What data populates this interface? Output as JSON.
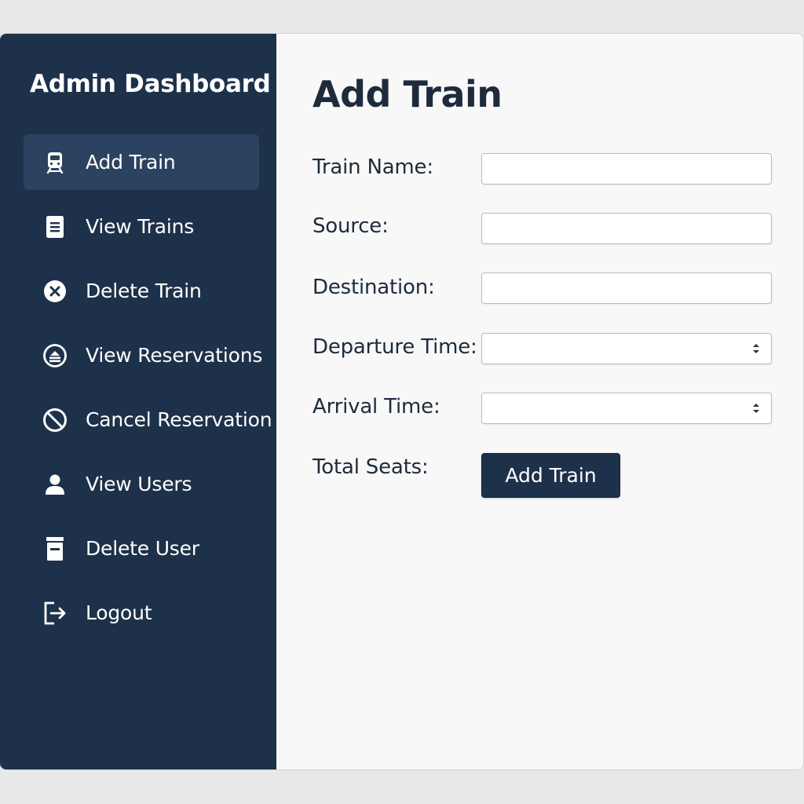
{
  "sidebar": {
    "title": "Admin Dashboard",
    "items": [
      {
        "label": "Add Train",
        "icon": "train-icon",
        "active": true
      },
      {
        "label": "View Trains",
        "icon": "document-icon",
        "active": false
      },
      {
        "label": "Delete Train",
        "icon": "close-circle-icon",
        "active": false
      },
      {
        "label": "View Reservations",
        "icon": "ticket-circle-icon",
        "active": false
      },
      {
        "label": "Cancel Reservation",
        "icon": "ban-icon",
        "active": false
      },
      {
        "label": "View Users",
        "icon": "user-icon",
        "active": false
      },
      {
        "label": "Delete User",
        "icon": "archive-icon",
        "active": false
      },
      {
        "label": "Logout",
        "icon": "logout-icon",
        "active": false
      }
    ]
  },
  "main": {
    "title": "Add Train",
    "form": {
      "train_name_label": "Train Name:",
      "train_name_value": "",
      "source_label": "Source:",
      "source_value": "",
      "destination_label": "Destination:",
      "destination_value": "",
      "departure_label": "Departure Time:",
      "departure_value": "",
      "arrival_label": "Arrival Time:",
      "arrival_value": "",
      "total_seats_label": "Total Seats:",
      "submit_label": "Add Train"
    }
  },
  "colors": {
    "sidebar_bg": "#1e314a",
    "active_item_bg": "#2b4260",
    "button_bg": "#1e314a",
    "main_bg": "#f8f8f8",
    "text_dark": "#1e2b3c"
  }
}
